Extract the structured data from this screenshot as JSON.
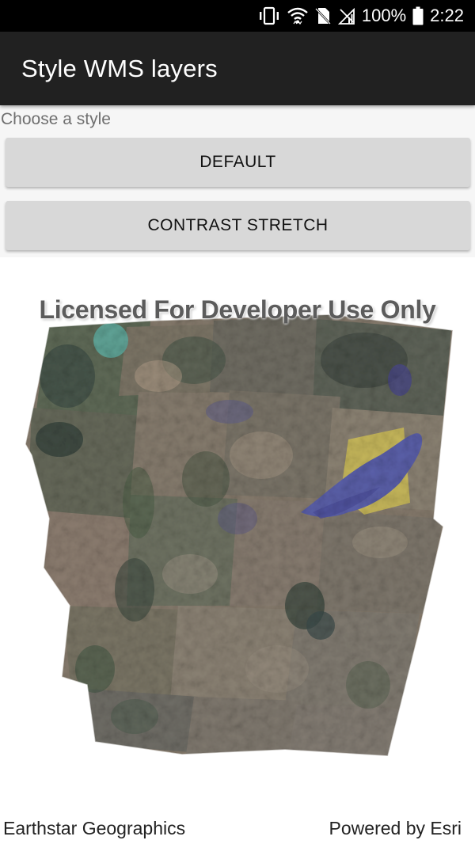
{
  "status_bar": {
    "battery_percent": "100%",
    "time": "2:22",
    "icons": [
      "vibrate-icon",
      "wifi-icon",
      "no-sim-icon",
      "signal-icon",
      "battery-icon"
    ]
  },
  "app_bar": {
    "title": "Style WMS layers"
  },
  "style_panel": {
    "prompt": "Choose a style",
    "buttons": [
      {
        "label": "DEFAULT"
      },
      {
        "label": "CONTRAST STRETCH"
      }
    ]
  },
  "map": {
    "watermark": "Licensed For Developer Use Only",
    "attribution_left": "Earthstar Geographics",
    "attribution_right": "Powered by Esri"
  },
  "colors": {
    "status_bar_bg": "#000000",
    "app_bar_bg": "#212121",
    "button_bg": "#d8d8d8",
    "content_bg": "#f6f6f6",
    "lake_color": "#5a5fa8",
    "sand_color": "#c8b85a"
  }
}
